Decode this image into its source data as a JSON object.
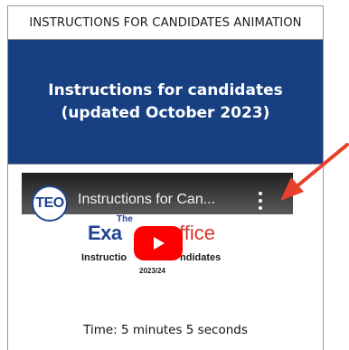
{
  "page_title": "INSTRUCTIONS FOR CANDIDATES ANIMATION",
  "hero_title": "Instructions for candidates (updated October 2023)",
  "video": {
    "channel_logo_text": "TEO",
    "title": "Instructions for Can...",
    "thumbnail": {
      "the_word": "The",
      "logo_left": "Exa",
      "logo_right": "ffice",
      "subtitle_left": "Instructio",
      "subtitle_right": "ndidates",
      "year": "2023/24"
    }
  },
  "duration": "Time: 5 minutes 5 seconds",
  "colors": {
    "hero_background": "#173f82",
    "play_button": "#ff0000",
    "arrow": "#e8402b"
  }
}
